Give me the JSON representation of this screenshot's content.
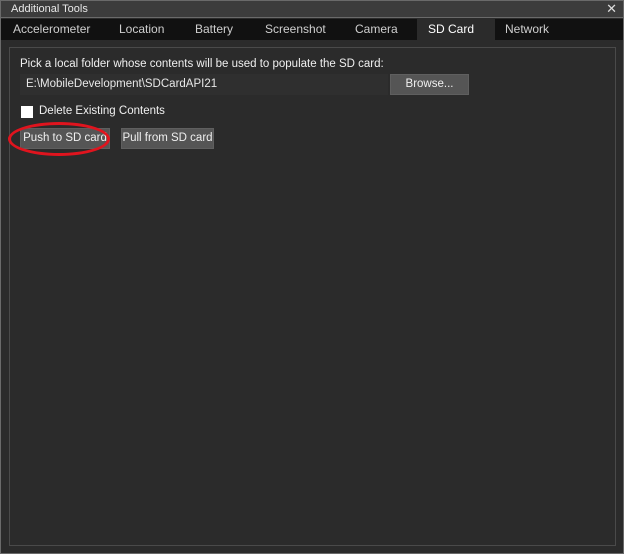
{
  "window": {
    "title": "Additional Tools",
    "close_icon": "close-icon"
  },
  "tabs": [
    {
      "label": "Accelerometer"
    },
    {
      "label": "Location"
    },
    {
      "label": "Battery"
    },
    {
      "label": "Screenshot"
    },
    {
      "label": "Camera"
    },
    {
      "label": "SD Card",
      "selected": true
    },
    {
      "label": "Network"
    }
  ],
  "sdcard": {
    "instruction": "Pick a local folder whose contents will be used to populate the SD card:",
    "folder_path": "E:\\MobileDevelopment\\SDCardAPI21",
    "browse_label": "Browse...",
    "delete_label": "Delete Existing Contents",
    "delete_checked": false,
    "push_label": "Push to SD card",
    "pull_label": "Pull from SD card"
  },
  "colors": {
    "highlight": "#e0141e"
  }
}
